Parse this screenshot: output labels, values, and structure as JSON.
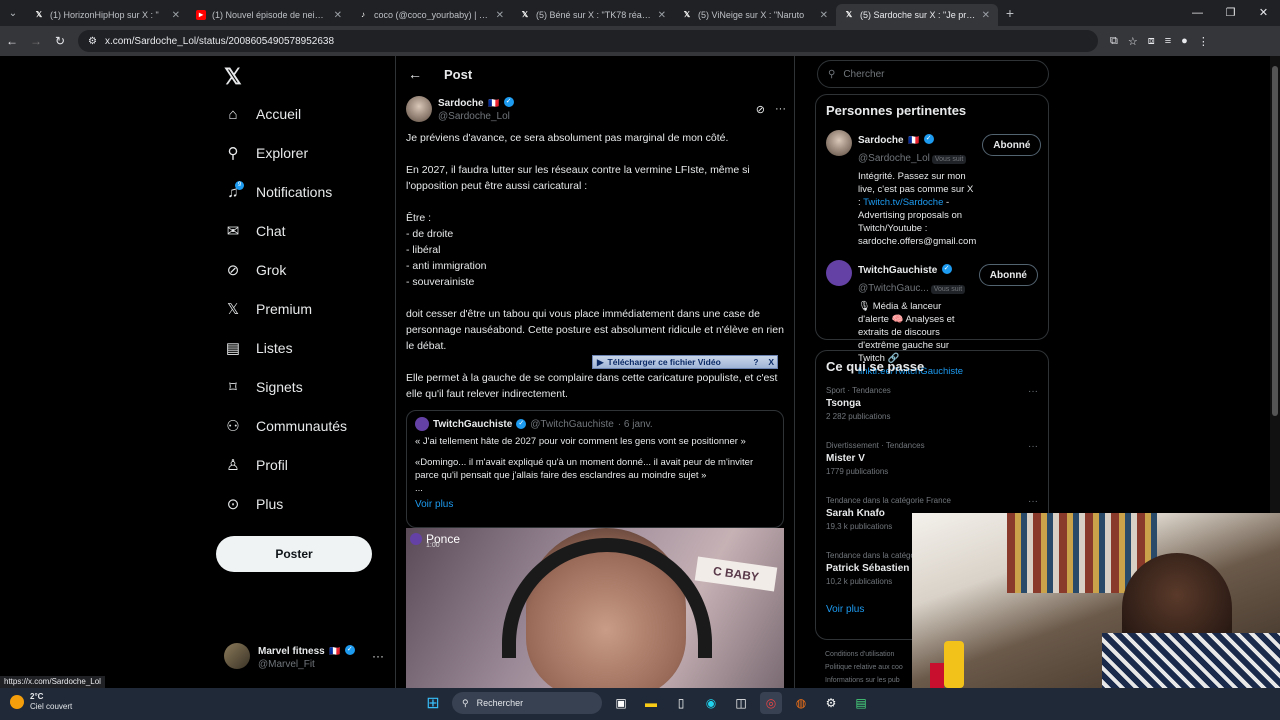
{
  "browser": {
    "tabs": [
      {
        "title": "(1) HorizonHipHop sur X : \"",
        "icon": "x-logo",
        "active": false
      },
      {
        "title": "(1) Nouvel épisode de neige : le",
        "icon": "youtube-logo",
        "active": false
      },
      {
        "title": "coco (@coco_yourbaby) | TikTo",
        "icon": "tiktok-logo",
        "active": false
      },
      {
        "title": "(5) Béné sur X : \"TK78 réagit à l",
        "icon": "x-logo",
        "active": false
      },
      {
        "title": "(5) ViNeige sur X : \"Naruto",
        "icon": "x-logo",
        "active": false
      },
      {
        "title": "(5) Sardoche sur X : \"Je prévi",
        "icon": "x-logo",
        "active": true
      }
    ],
    "url": "x.com/Sardoche_Lol/status/2008605490578952638",
    "status_url": "https://x.com/Sardoche_Lol"
  },
  "nav": {
    "items": [
      {
        "label": "Accueil",
        "icon": "home-icon"
      },
      {
        "label": "Explorer",
        "icon": "search-icon"
      },
      {
        "label": "Notifications",
        "icon": "bell-icon",
        "badge": "9"
      },
      {
        "label": "Chat",
        "icon": "mail-icon"
      },
      {
        "label": "Grok",
        "icon": "grok-icon"
      },
      {
        "label": "Premium",
        "icon": "x-logo-icon"
      },
      {
        "label": "Listes",
        "icon": "list-icon"
      },
      {
        "label": "Signets",
        "icon": "bookmark-icon"
      },
      {
        "label": "Communautés",
        "icon": "communities-icon"
      },
      {
        "label": "Profil",
        "icon": "person-icon"
      },
      {
        "label": "Plus",
        "icon": "more-circle-icon"
      }
    ],
    "post_button": "Poster",
    "account": {
      "name": "Marvel fitness",
      "flag": "🇫🇷",
      "handle": "@Marvel_Fit"
    }
  },
  "main": {
    "header": "Post",
    "tweet": {
      "author": "Sardoche",
      "flag": "🇫🇷",
      "handle": "@Sardoche_Lol",
      "lines": [
        "Je préviens d'avance, ce sera absolument pas marginal de mon côté.",
        "",
        "En 2027, il faudra lutter sur les réseaux contre la vermine LFIste, même si l'opposition peut être aussi caricatural :",
        "",
        "Être :",
        "- de droite",
        "- libéral",
        "- anti immigration",
        "- souverainiste",
        "",
        "doit cesser d'être un tabou qui vous place immédiatement dans une case de personnage nauséabond. Cette posture est absolument ridicule et n'élève en rien le débat.",
        "",
        "Elle permet à la gauche de se complaire dans cette caricature populiste, et c'est elle qu'il faut relever indirectement."
      ],
      "download_bar": "Télécharger ce fichier Vidéo",
      "download_help": "?",
      "download_close": "X"
    },
    "quote": {
      "author": "TwitchGauchiste",
      "handle": "@TwitchGauchiste",
      "date": "· 6 janv.",
      "line1": "« J'ai tellement hâte de 2027 pour voir comment les gens vont se positionner »",
      "line2": "«Domingo... il m'avait expliqué qu'à un moment donné... il avait peur de m'inviter parce qu'il pensait que j'allais faire des esclandres au moindre sujet »",
      "line3": "...",
      "more": "Voir plus"
    },
    "video": {
      "channel": "Ponce",
      "timer": "1:00",
      "sign": "C BABY"
    }
  },
  "right": {
    "search_placeholder": "Chercher",
    "relevant_title": "Personnes pertinentes",
    "people": [
      {
        "name": "Sardoche",
        "flag": "🇫🇷",
        "handle": "@Sardoche_Lol",
        "follows_you": "Vous suit",
        "button": "Abonné",
        "bio_prefix": "Intégrité. Passez sur mon live, c'est pas comme sur X : ",
        "bio_link": "Twitch.tv/Sardoche",
        "bio_suffix": " - Advertising proposals on Twitch/Youtube : sardoche.offers@gmail.com"
      },
      {
        "name": "TwitchGauchiste",
        "flag": "",
        "handle": "@TwitchGauc...",
        "follows_you": "Vous suit",
        "button": "Abonné",
        "bio_prefix": "🎙 Média & lanceur d'alerte 🧠 Analyses et extraits de discours d'extrême gauche sur Twitch 🔗 ",
        "bio_link": "linktr.ee/TwitchGauchiste",
        "bio_suffix": ""
      }
    ],
    "trends_title": "Ce qui se passe",
    "trends": [
      {
        "category": "Sport · Tendances",
        "name": "Tsonga",
        "count": "2 282 publications"
      },
      {
        "category": "Divertissement · Tendances",
        "name": "Mister V",
        "count": "1779 publications"
      },
      {
        "category": "Tendance dans la catégorie France",
        "name": "Sarah Knafo",
        "count": "19,3 k publications"
      },
      {
        "category": "Tendance dans la catégorie",
        "name": "Patrick Sébastien",
        "count": "10,2 k publications"
      }
    ],
    "see_more": "Voir plus",
    "footer": [
      "Conditions d'utilisation",
      "Politique relative aux coo",
      "Informations sur les pub"
    ]
  },
  "taskbar": {
    "temp": "2°C",
    "weather": "Ciel couvert",
    "search": "Rechercher"
  },
  "colors": {
    "accent": "#1d9bf0",
    "bg": "#000000",
    "border": "#2f3336"
  }
}
